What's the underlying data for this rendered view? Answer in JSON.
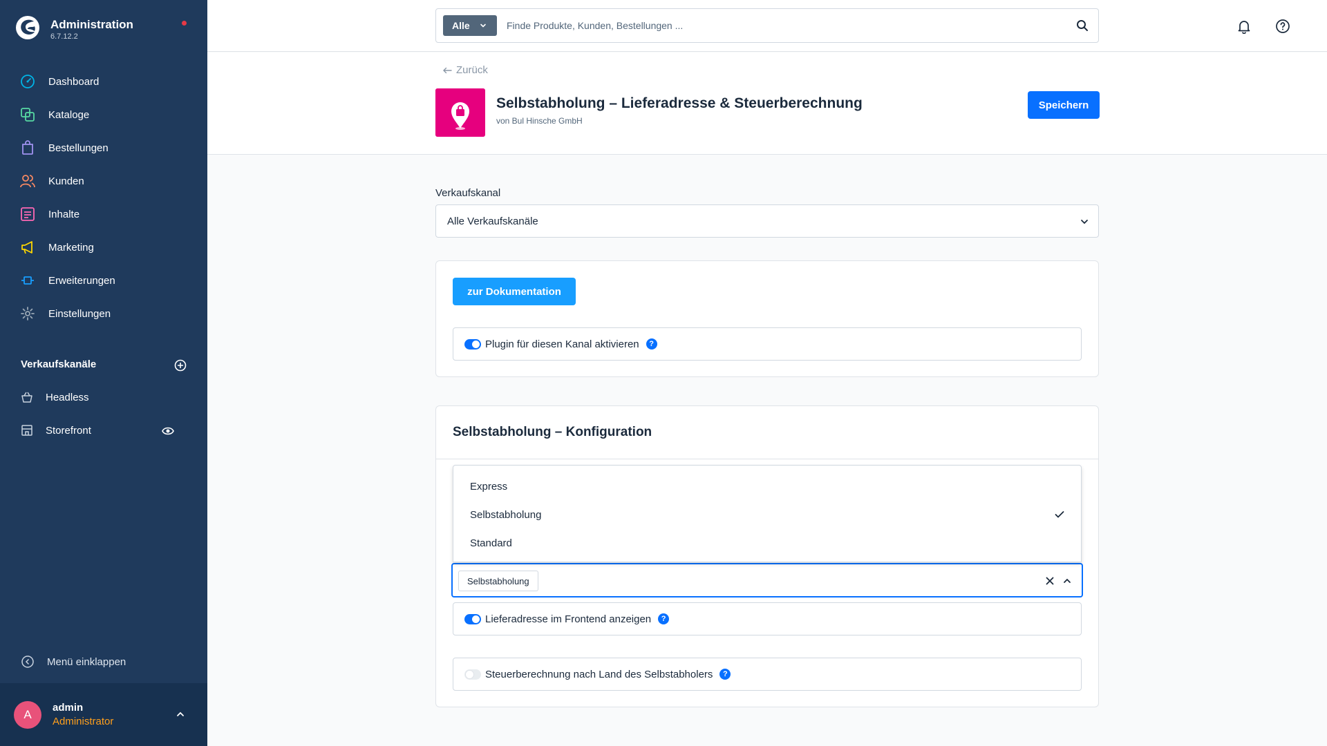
{
  "app": {
    "title": "Administration",
    "version": "6.7.12.2"
  },
  "sidebar": {
    "items": [
      {
        "label": "Dashboard",
        "icon": "dashboard-icon",
        "color": "#00b4e6"
      },
      {
        "label": "Kataloge",
        "icon": "catalog-icon",
        "color": "#57d9a3"
      },
      {
        "label": "Bestellungen",
        "icon": "orders-icon",
        "color": "#a092f0"
      },
      {
        "label": "Kunden",
        "icon": "customers-icon",
        "color": "#f88962"
      },
      {
        "label": "Inhalte",
        "icon": "content-icon",
        "color": "#ff68b4"
      },
      {
        "label": "Marketing",
        "icon": "marketing-icon",
        "color": "#ffd700"
      },
      {
        "label": "Erweiterungen",
        "icon": "extensions-icon",
        "color": "#189eff"
      },
      {
        "label": "Einstellungen",
        "icon": "settings-icon",
        "color": "#9aa8b5"
      }
    ],
    "sales_channels_heading": "Verkaufskanäle",
    "sales_channels": [
      {
        "label": "Headless",
        "icon": "basket-icon"
      },
      {
        "label": "Storefront",
        "icon": "storefront-icon"
      }
    ],
    "collapse_label": "Menü einklappen"
  },
  "user": {
    "initial": "A",
    "name": "admin",
    "role": "Administrator"
  },
  "search": {
    "type_label": "Alle",
    "placeholder": "Finde Produkte, Kunden, Bestellungen ..."
  },
  "header": {
    "back_label": "Zurück",
    "title": "Selbstabholung – Lieferadresse & Steuerberechnung",
    "vendor": "von Bul Hinsche GmbH",
    "save_label": "Speichern",
    "icon_color": "#e6007e"
  },
  "sales_channel_field": {
    "label": "Verkaufskanal",
    "value": "Alle Verkaufskanäle"
  },
  "general_card": {
    "doc_button": "zur Dokumentation",
    "activate_label": "Plugin für diesen Kanal aktivieren",
    "activate_on": true
  },
  "config_card": {
    "title": "Selbstabholung – Konfiguration",
    "dropdown_options": [
      {
        "label": "Express",
        "selected": false
      },
      {
        "label": "Selbstabholung",
        "selected": true
      },
      {
        "label": "Standard",
        "selected": false
      }
    ],
    "selected_chip": "Selbstabholung",
    "toggles": [
      {
        "label": "Lieferadresse im Frontend anzeigen",
        "on": true
      },
      {
        "label": "Steuerberechnung nach Land des Selbstabholers",
        "on": false
      }
    ]
  },
  "colors": {
    "sidebar_bg": "#1f3a5c",
    "primary": "#0870ff",
    "doc_button": "#189eff"
  }
}
